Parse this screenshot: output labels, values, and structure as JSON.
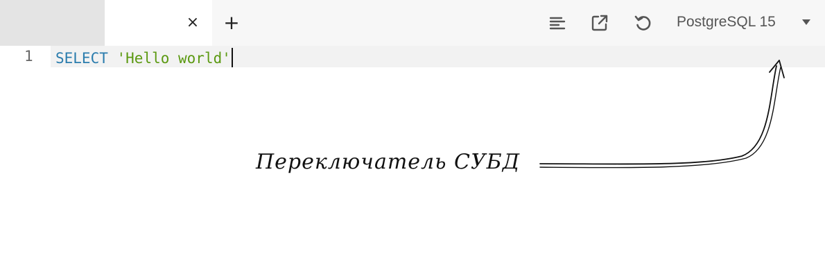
{
  "tabs": [
    {
      "label": ""
    },
    {
      "label": "",
      "close_icon": "×"
    }
  ],
  "toolbar": {
    "add_tab_icon": "+",
    "icons": [
      "format-icon",
      "external-link-icon",
      "reset-icon"
    ],
    "db_selector": {
      "label": "PostgreSQL 15",
      "caret": "chevron-down-icon"
    }
  },
  "editor": {
    "line_number": "1",
    "code_keyword": "SELECT",
    "code_string": "'Hello world'"
  },
  "annotation": {
    "text": "Переключатель СУБД"
  },
  "colors": {
    "keyword": "#2a7cad",
    "string": "#5b9911",
    "active_tab": "#ffffff",
    "inactive_tab": "#e4e4e4"
  }
}
